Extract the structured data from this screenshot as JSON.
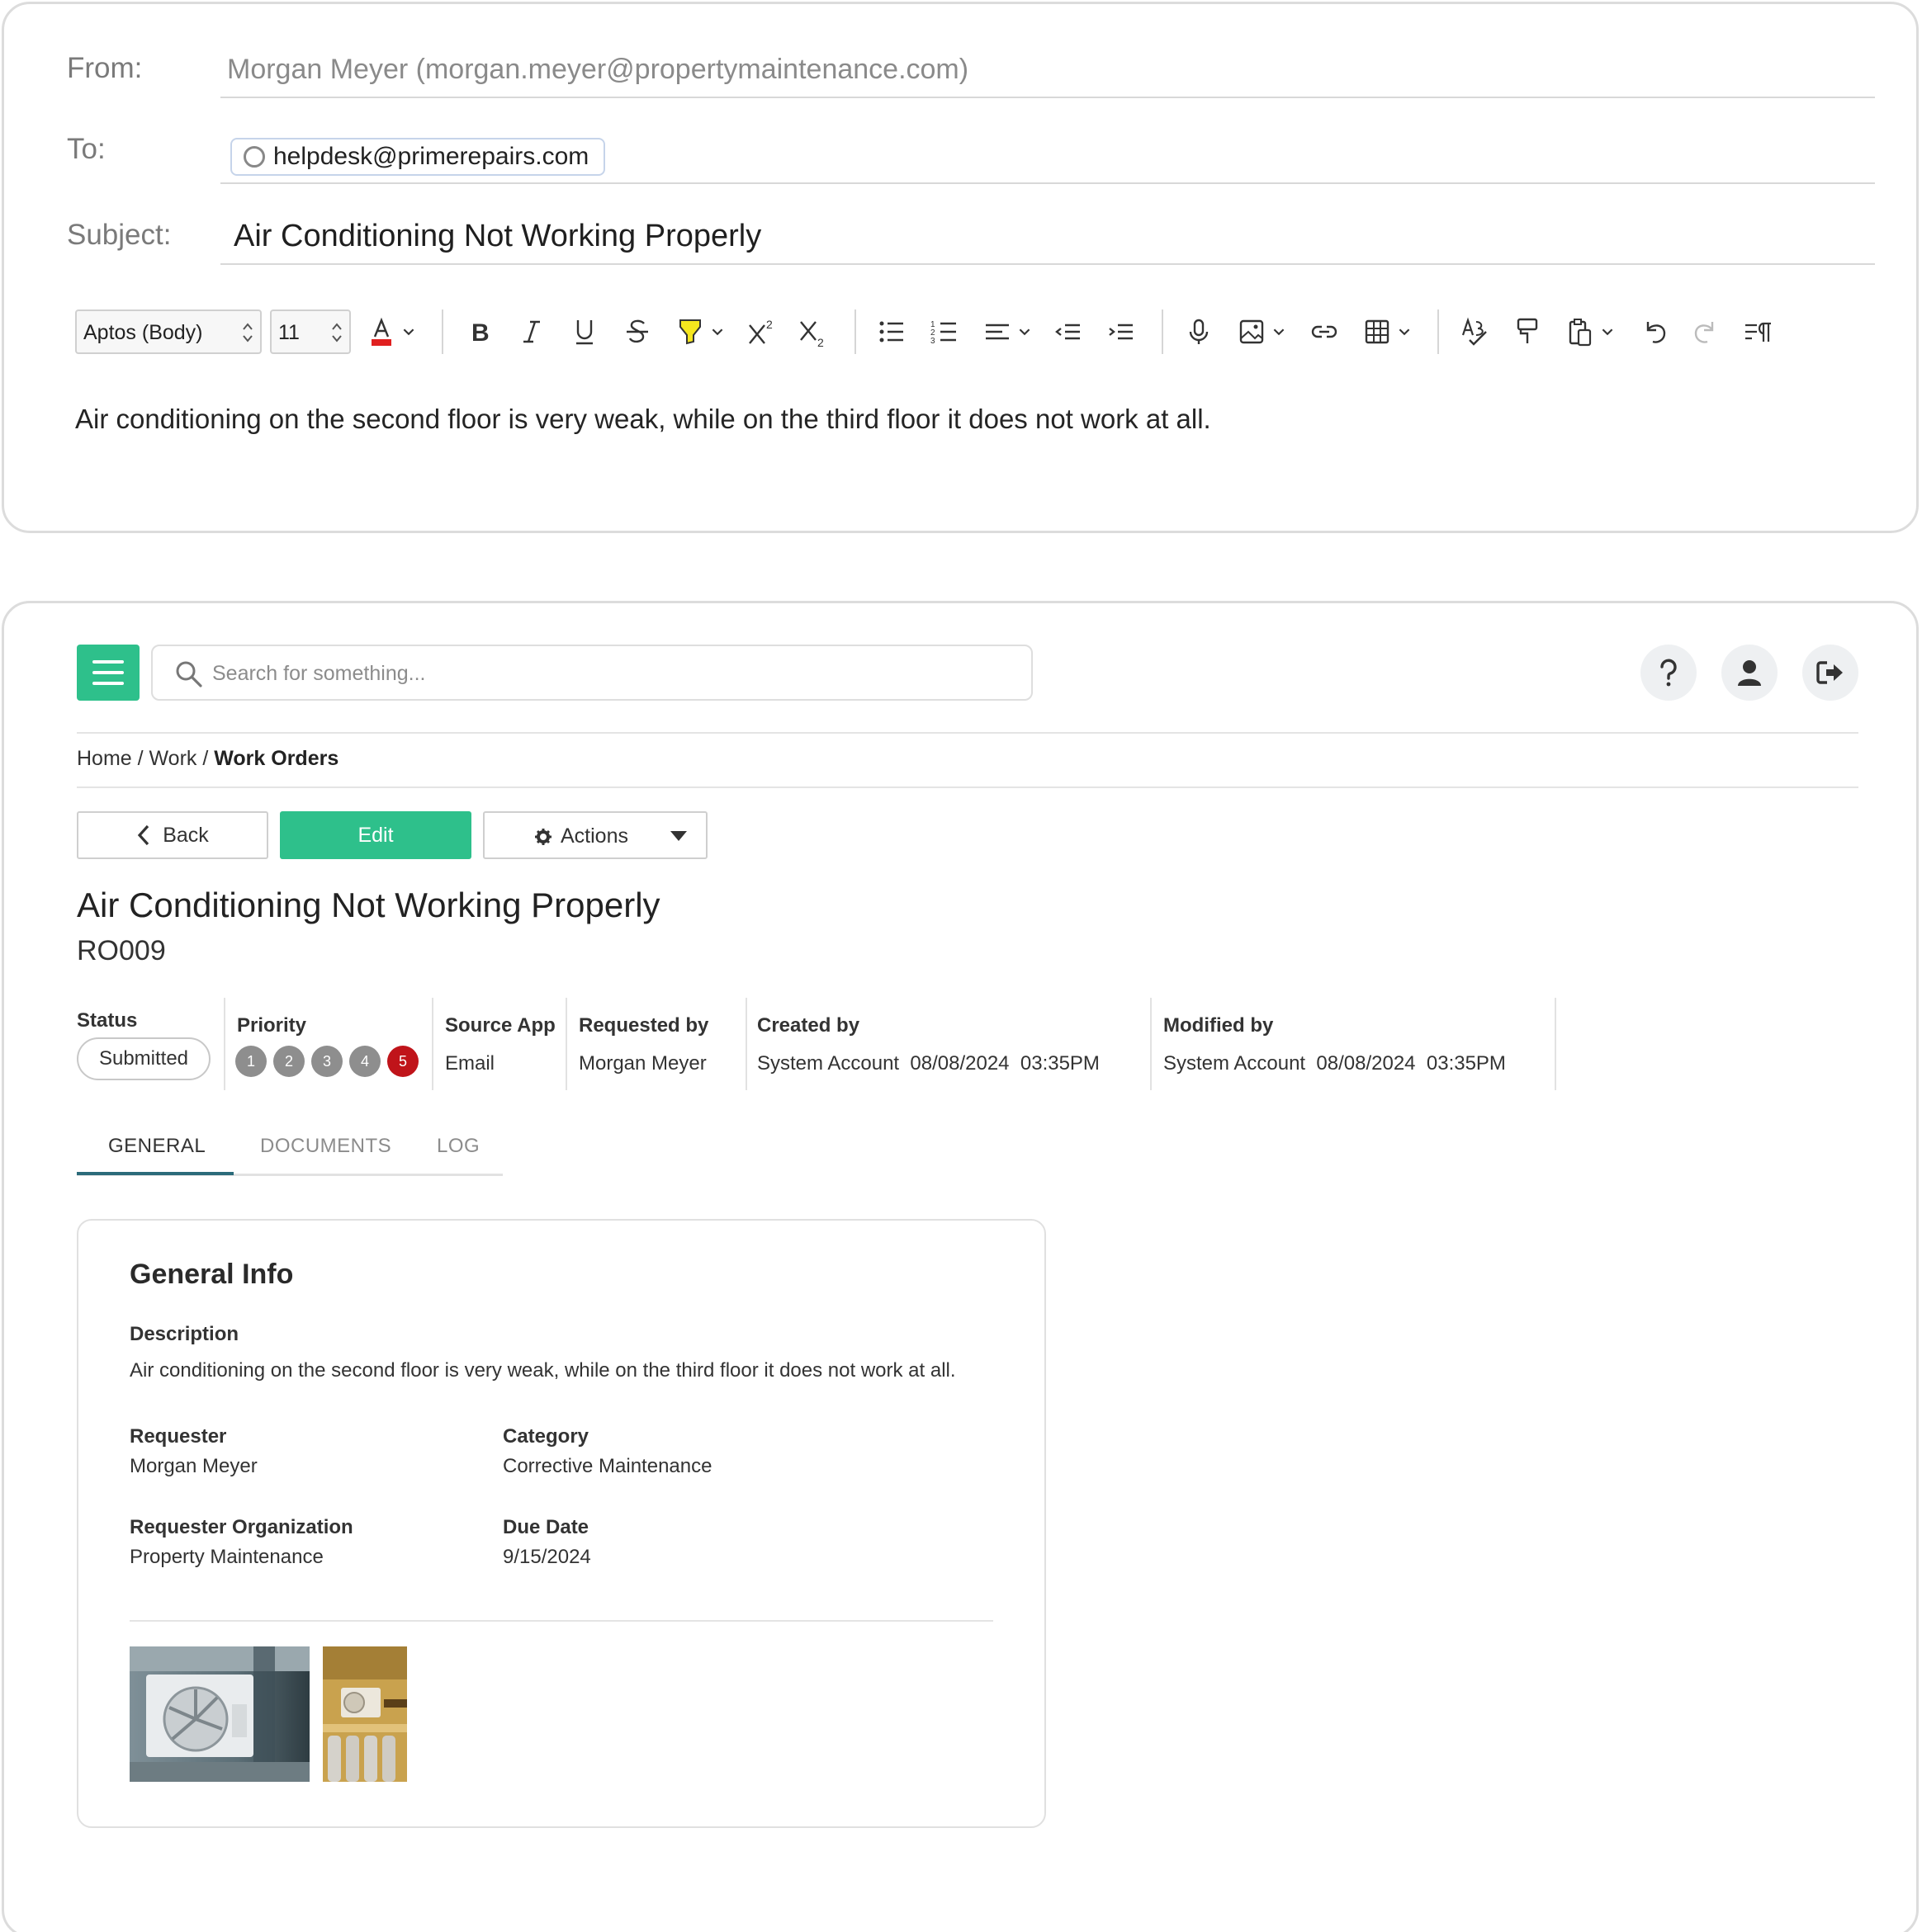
{
  "email": {
    "from_label": "From:",
    "from_value": "Morgan Meyer (morgan.meyer@propertymaintenance.com)",
    "to_label": "To:",
    "to_value": "helpdesk@primerepairs.com",
    "subject_label": "Subject:",
    "subject_value": "Air Conditioning Not Working Properly",
    "toolbar": {
      "font_name": "Aptos (Body)",
      "font_size": "11",
      "font_color": "#e02020",
      "highlight_color": "#f5e61e",
      "icons": [
        "font-color-icon",
        "bold-icon",
        "italic-icon",
        "underline-icon",
        "strikethrough-icon",
        "highlight-icon",
        "superscript-icon",
        "subscript-icon",
        "bullet-list-icon",
        "numbered-list-icon",
        "align-icon",
        "outdent-icon",
        "indent-icon",
        "dictate-icon",
        "image-icon",
        "link-icon",
        "table-icon",
        "spellcheck-icon",
        "format-painter-icon",
        "paste-icon",
        "undo-icon",
        "redo-icon",
        "paragraph-icon"
      ]
    },
    "body": "Air conditioning on the second floor is very weak, while on the third floor it does not work at all."
  },
  "workorder": {
    "search_placeholder": "Search for something...",
    "accent_color": "#2ec08b",
    "breadcrumb": {
      "home": "Home",
      "work": "Work",
      "current": "Work Orders",
      "separator": " / "
    },
    "buttons": {
      "back": "Back",
      "edit": "Edit",
      "actions": "Actions"
    },
    "title": "Air Conditioning Not Working Properly",
    "id": "RO009",
    "meta": {
      "status_label": "Status",
      "status_value": "Submitted",
      "priority_label": "Priority",
      "priority_levels": [
        "1",
        "2",
        "3",
        "4",
        "5"
      ],
      "priority_selected": "5",
      "priority_active_color": "#c0141a",
      "source_label": "Source App",
      "source_value": "Email",
      "requested_label": "Requested by",
      "requested_value": "Morgan Meyer",
      "created_label": "Created by",
      "created_value": "System Account  08/08/2024  03:35PM",
      "modified_label": "Modified by",
      "modified_value": "System Account  08/08/2024  03:35PM"
    },
    "tabs": [
      "GENERAL",
      "DOCUMENTS",
      "LOG"
    ],
    "active_tab": "GENERAL",
    "general_info": {
      "title": "General Info",
      "description_label": "Description",
      "description_value": "Air conditioning on the second floor is very weak, while on the third floor it does not work at all.",
      "requester_label": "Requester",
      "requester_value": "Morgan Meyer",
      "category_label": "Category",
      "category_value": "Corrective Maintenance",
      "org_label": "Requester Organization",
      "org_value": "Property Maintenance",
      "due_label": "Due Date",
      "due_value": "9/15/2024",
      "attachments": [
        "ac-unit-photo-1",
        "ac-unit-photo-2"
      ]
    }
  }
}
